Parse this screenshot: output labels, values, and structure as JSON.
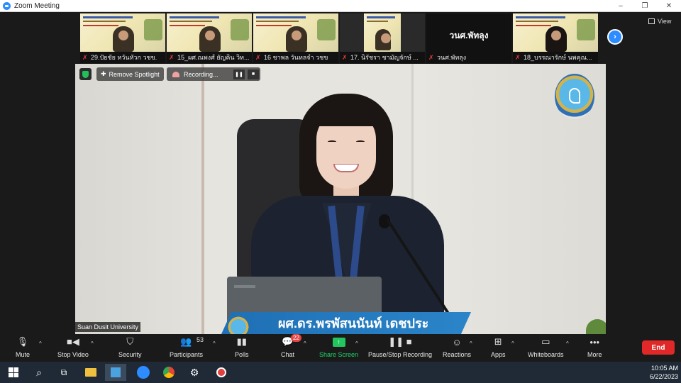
{
  "window": {
    "title": "Zoom Meeting",
    "controls": [
      "–",
      "❐",
      "✕"
    ]
  },
  "thumbnails": [
    {
      "name": "29.ปัยชัย หวันหัวก วชข.",
      "muted": true,
      "kind": "slide"
    },
    {
      "name": "15_ผศ.ณพงศ์ ยัญคิน วิท...",
      "muted": true,
      "kind": "slide"
    },
    {
      "name": "16 ชาพล วันทลจำ วชข",
      "muted": true,
      "kind": "slide"
    },
    {
      "name": "17. นิรัชรา ชามัญจักษ์ ...",
      "muted": true,
      "kind": "small"
    },
    {
      "name": "วนศ.พัทลุง",
      "muted": true,
      "kind": "dark",
      "center_label": "วนศ.พัทลุง"
    },
    {
      "name": "18_บรรณารักษ์ นพคุณ...",
      "muted": true,
      "kind": "slide"
    }
  ],
  "view_label": "View",
  "main_video": {
    "remove_spotlight": "Remove Spotlight",
    "recording": "Recording...",
    "name_banner": "ผศ.ดร.พรพัสนนันท์ เดชประ",
    "org_label": "Suan Dusit University"
  },
  "toolbar": {
    "mute": "Mute",
    "stop_video": "Stop Video",
    "security": "Security",
    "participants": "Participants",
    "participants_count": "53",
    "polls": "Polls",
    "chat": "Chat",
    "chat_badge": "22",
    "share_screen": "Share Screen",
    "pause_recording": "Pause/Stop Recording",
    "reactions": "Reactions",
    "apps": "Apps",
    "whiteboards": "Whiteboards",
    "more": "More",
    "end": "End"
  },
  "taskbar": {
    "time": "10:05 AM",
    "date": "6/22/2023"
  },
  "colors": {
    "zoom_blue": "#2d8cff",
    "share_green": "#22c55e",
    "end_red": "#e02828",
    "muted_red": "#e63b3b"
  }
}
